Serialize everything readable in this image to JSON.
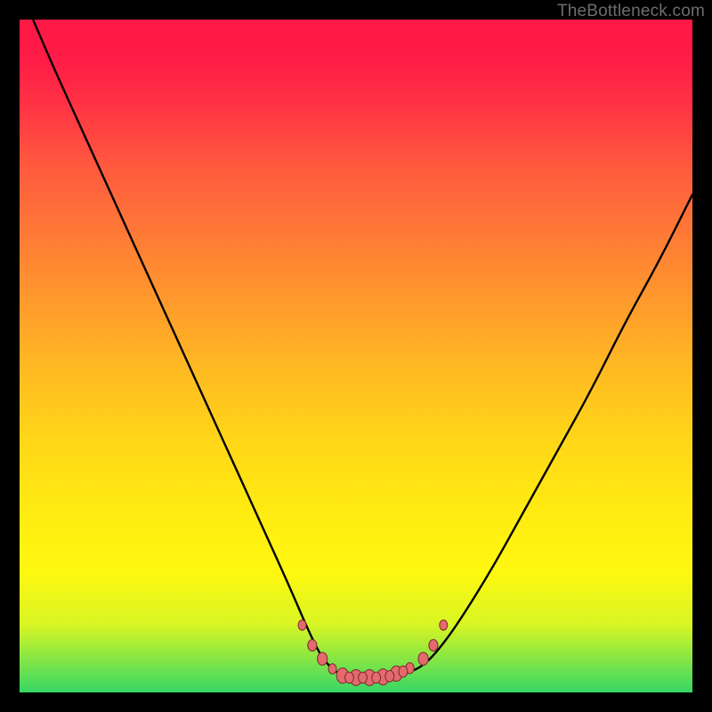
{
  "watermark": "TheBottleneck.com",
  "chart_data": {
    "type": "line",
    "title": "",
    "xlabel": "",
    "ylabel": "",
    "xlim": [
      0,
      100
    ],
    "ylim": [
      0,
      100
    ],
    "grid": false,
    "legend": false,
    "series": [
      {
        "name": "curve",
        "x": [
          2,
          5,
          10,
          15,
          20,
          25,
          30,
          35,
          40,
          43,
          45,
          47,
          49,
          52,
          55,
          58,
          60,
          62,
          65,
          70,
          75,
          80,
          85,
          90,
          95,
          100
        ],
        "y": [
          100,
          93,
          82,
          71,
          60,
          49,
          38,
          27,
          16,
          9,
          5,
          3,
          2,
          2,
          2,
          3,
          4,
          6,
          10,
          18,
          27,
          36,
          45,
          55,
          64,
          74
        ]
      }
    ],
    "marker_cluster": {
      "name": "beads",
      "points": [
        {
          "x": 42.0,
          "y": 10.0,
          "r": 3.2
        },
        {
          "x": 43.5,
          "y": 7.0,
          "r": 3.6
        },
        {
          "x": 45.0,
          "y": 5.0,
          "r": 4.0
        },
        {
          "x": 46.5,
          "y": 3.5,
          "r": 3.2
        },
        {
          "x": 48.0,
          "y": 2.5,
          "r": 4.8
        },
        {
          "x": 50.0,
          "y": 2.2,
          "r": 5.0
        },
        {
          "x": 52.0,
          "y": 2.2,
          "r": 5.0
        },
        {
          "x": 54.0,
          "y": 2.3,
          "r": 5.0
        },
        {
          "x": 56.0,
          "y": 2.8,
          "r": 4.8
        },
        {
          "x": 58.0,
          "y": 3.6,
          "r": 3.4
        },
        {
          "x": 60.0,
          "y": 5.0,
          "r": 4.0
        },
        {
          "x": 61.5,
          "y": 7.0,
          "r": 3.6
        },
        {
          "x": 63.0,
          "y": 10.0,
          "r": 3.2
        },
        {
          "x": 49.0,
          "y": 2.2,
          "r": 3.5
        },
        {
          "x": 51.0,
          "y": 2.2,
          "r": 3.5
        },
        {
          "x": 53.0,
          "y": 2.2,
          "r": 3.5
        },
        {
          "x": 55.0,
          "y": 2.4,
          "r": 3.5
        },
        {
          "x": 57.0,
          "y": 3.1,
          "r": 3.5
        }
      ]
    }
  }
}
